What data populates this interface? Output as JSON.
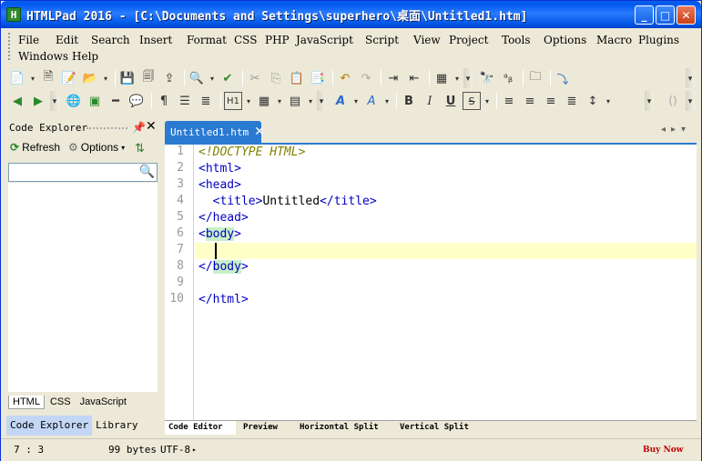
{
  "window": {
    "title": "HTMLPad 2016 - [C:\\Documents and Settings\\superhero\\桌面\\Untitled1.htm]",
    "app_icon": "H"
  },
  "menu": [
    {
      "label": "File"
    },
    {
      "label": "Edit"
    },
    {
      "label": "Search"
    },
    {
      "label": "Insert"
    },
    {
      "label": "Format"
    },
    {
      "label": "CSS"
    },
    {
      "label": "PHP"
    },
    {
      "label": "JavaScript"
    },
    {
      "label": "Script"
    },
    {
      "label": "View"
    },
    {
      "label": "Project"
    },
    {
      "label": "Tools"
    },
    {
      "label": "Options"
    },
    {
      "label": "Macro"
    },
    {
      "label": "Plugins"
    },
    {
      "label": "Windows"
    },
    {
      "label": "Help"
    }
  ],
  "code_explorer": {
    "title": "Code Explorer",
    "refresh_label": "Refresh",
    "options_label": "Options",
    "search_value": "",
    "lang_tabs": [
      "HTML",
      "CSS",
      "JavaScript"
    ],
    "bottom_tabs": [
      "Code Explorer",
      "Library"
    ]
  },
  "editor": {
    "tab_label": "Untitled1.htm",
    "line_numbers": [
      "1",
      "2",
      "3",
      "4",
      "5",
      "6",
      "7",
      "8",
      "9",
      "10"
    ],
    "view_tabs": [
      "Code Editor",
      "Preview",
      "Horizontal Split",
      "Vertical Split"
    ]
  },
  "status": {
    "position": "7 : 3",
    "size": "99 bytes",
    "encoding": "UTF-8",
    "buy_now": "Buy Now"
  },
  "colors": {
    "tag": "#0000C0",
    "doctype": "#808000",
    "text": "#000000",
    "highlight_body": "#C8F0C8",
    "caret_line": "#FFFFC8",
    "tab_blue": "#2A7AD2"
  }
}
